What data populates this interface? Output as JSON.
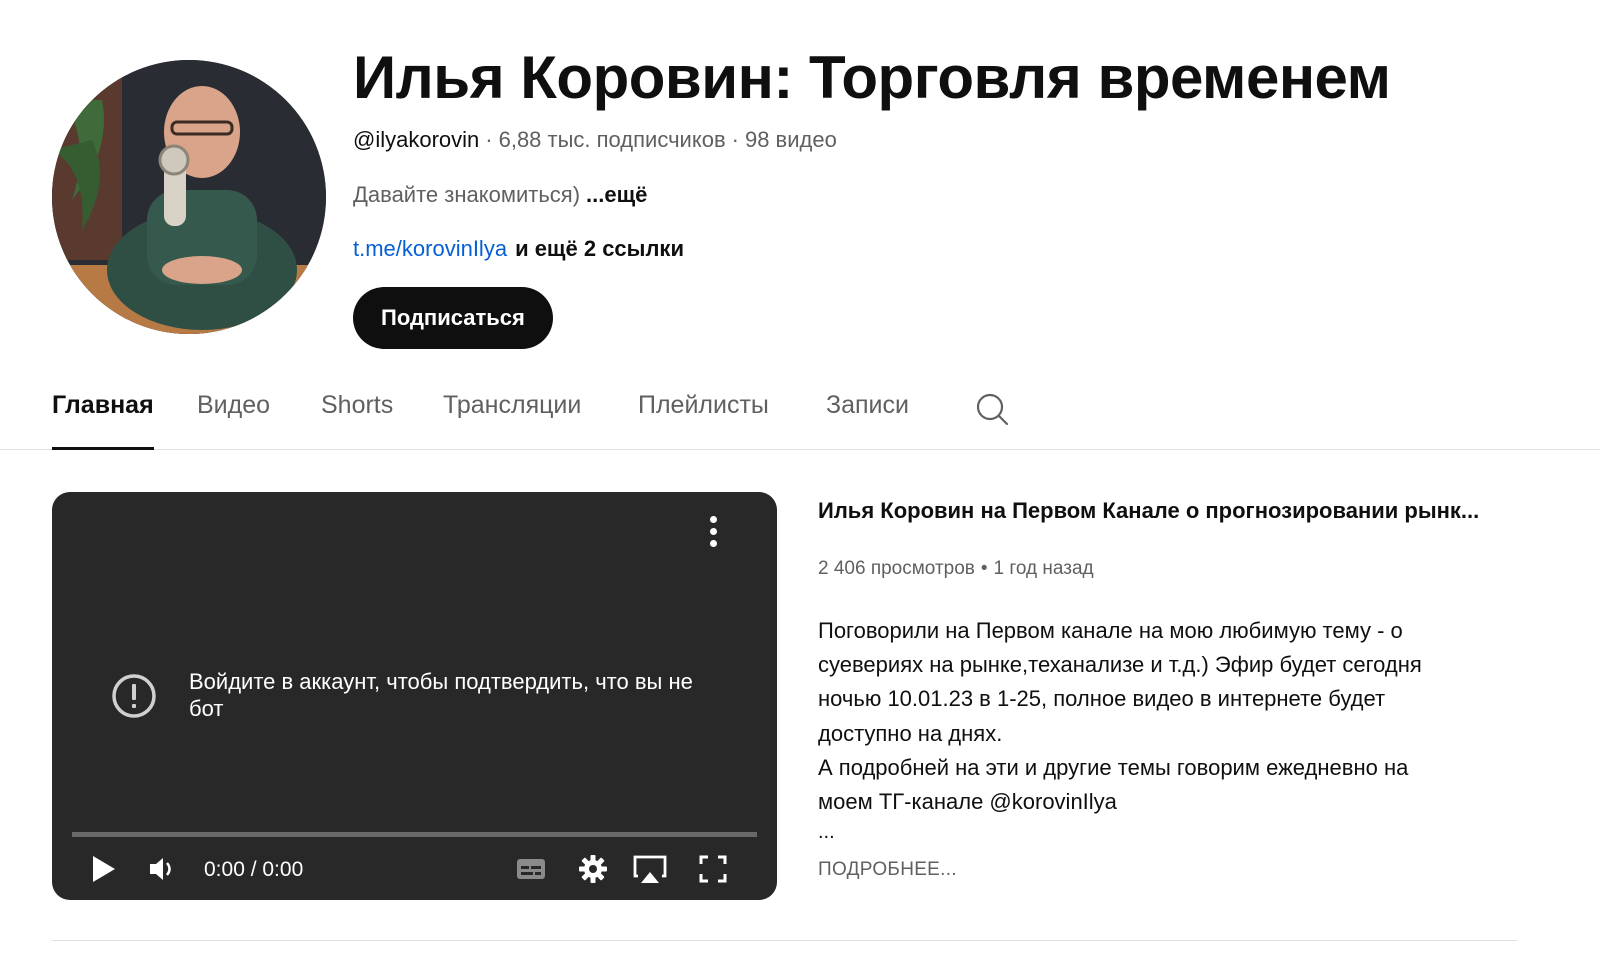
{
  "header": {
    "title": "Илья Коровин: Торговля временем",
    "handle": "@ilyakorovin",
    "separator": "·",
    "subscribers": "6,88 тыс. подписчиков",
    "video_count": "98 видео",
    "description": "Давайте знакомиться)",
    "description_more": "...ещё",
    "link_text": "t.me/korovinIlya",
    "more_links": "и ещё 2 ссылки",
    "subscribe_label": "Подписаться"
  },
  "tabs": [
    {
      "label": "Главная",
      "active": true
    },
    {
      "label": "Видео",
      "active": false
    },
    {
      "label": "Shorts",
      "active": false
    },
    {
      "label": "Трансляции",
      "active": false
    },
    {
      "label": "Плейлисты",
      "active": false
    },
    {
      "label": "Записи",
      "active": false
    }
  ],
  "player": {
    "message": "Войдите в аккаунт, чтобы подтвердить, что вы не бот",
    "time": "0:00 / 0:00",
    "progress": 0,
    "progress_color": "#ff0000"
  },
  "video": {
    "title": "Илья Коровин на Первом Канале о прогнозировании рынк...",
    "views": "2 406 просмотров",
    "dot": "•",
    "age": "1 год назад",
    "description_lines": [
      "Поговорили на Первом канале на мою любимую тему - о",
      "суевериях на рынке,теханализе и т.д.)  Эфир будет сегодня",
      "ночью 10.01.23  в 1-25, полное видео в интернете будет",
      "доступно на днях.",
      "А подробней на эти и другие темы говорим ежедневно на",
      "моем ТГ-канале  @korovinIlya"
    ],
    "ellipsis": "...",
    "read_more": "ПОДРОБНЕЕ..."
  },
  "colors": {
    "link": "#065fd4",
    "secondary_text": "#606060",
    "player_bg": "#282828"
  }
}
